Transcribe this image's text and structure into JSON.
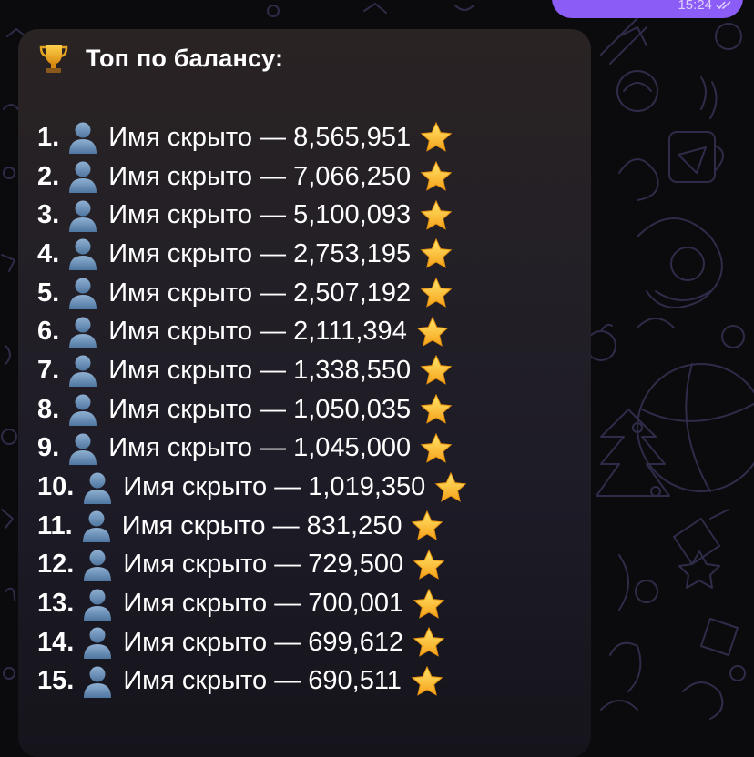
{
  "top_message": {
    "time": "15:24"
  },
  "message": {
    "icon": "trophy-icon",
    "title": "Топ по балансу:",
    "entries": [
      {
        "rank": "1.",
        "name": "Имя скрыто",
        "sep": "—",
        "value": "8,565,951"
      },
      {
        "rank": "2.",
        "name": "Имя скрыто",
        "sep": "—",
        "value": "7,066,250"
      },
      {
        "rank": "3.",
        "name": "Имя скрыто",
        "sep": "—",
        "value": "5,100,093"
      },
      {
        "rank": "4.",
        "name": "Имя скрыто",
        "sep": "—",
        "value": "2,753,195"
      },
      {
        "rank": "5.",
        "name": "Имя скрыто",
        "sep": "—",
        "value": "2,507,192"
      },
      {
        "rank": "6.",
        "name": "Имя скрыто",
        "sep": "—",
        "value": "2,111,394"
      },
      {
        "rank": "7.",
        "name": "Имя скрыто",
        "sep": "—",
        "value": "1,338,550"
      },
      {
        "rank": "8.",
        "name": "Имя скрыто",
        "sep": "—",
        "value": "1,050,035"
      },
      {
        "rank": "9.",
        "name": "Имя скрыто",
        "sep": "—",
        "value": "1,045,000"
      },
      {
        "rank": "10.",
        "name": "Имя скрыто",
        "sep": "—",
        "value": "1,019,350"
      },
      {
        "rank": "11.",
        "name": "Имя скрыто",
        "sep": "—",
        "value": "831,250"
      },
      {
        "rank": "12.",
        "name": "Имя скрыто",
        "sep": "—",
        "value": "729,500"
      },
      {
        "rank": "13.",
        "name": "Имя скрыто",
        "sep": "—",
        "value": "700,001"
      },
      {
        "rank": "14.",
        "name": "Имя скрыто",
        "sep": "—",
        "value": "699,612"
      },
      {
        "rank": "15.",
        "name": "Имя скрыто",
        "sep": "—",
        "value": "690,511"
      }
    ]
  },
  "colors": {
    "chat_background": "#0b0b0e",
    "doodle_stroke": "#2e2c48",
    "sent_bubble": "#8b5cf6",
    "received_bubble_top": "#2a2323",
    "received_bubble_bottom": "#15141b",
    "text": "#ffffff"
  }
}
